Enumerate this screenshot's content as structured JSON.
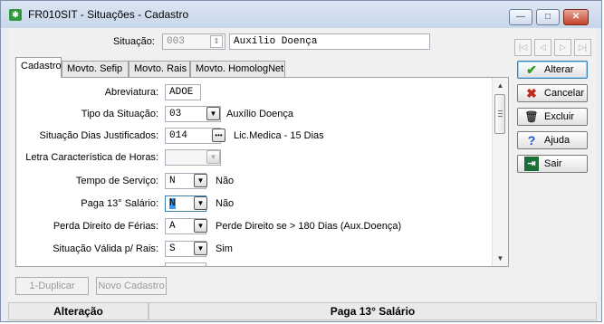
{
  "window": {
    "title": "FR010SIT - Situações - Cadastro",
    "app_icon_glyph": "✱",
    "minimize_glyph": "—",
    "maximize_glyph": "□",
    "close_glyph": "✕"
  },
  "header": {
    "situacao_label": "Situação:",
    "situacao_code": "003",
    "situacao_desc": "Auxílio Doença"
  },
  "nav_buttons": [
    "|◁",
    "◁",
    "▷",
    "▷|"
  ],
  "tabs": [
    {
      "label": "Cadastro",
      "active": true
    },
    {
      "label": "Movto. Sefip",
      "active": false
    },
    {
      "label": "Movto. Rais",
      "active": false
    },
    {
      "label": "Movto. HomologNet",
      "active": false
    }
  ],
  "form": {
    "abreviatura": {
      "label": "Abreviatura:",
      "value": "ADOE"
    },
    "tipo_situacao": {
      "label": "Tipo da Situação:",
      "value": "03",
      "desc": "Auxílio Doença"
    },
    "dias_justificados": {
      "label": "Situação Dias Justificados:",
      "value": "014",
      "button": "•••",
      "desc": "Lic.Medica - 15 Dias"
    },
    "letra_horas": {
      "label": "Letra Característica de Horas:",
      "value": ""
    },
    "tempo_servico": {
      "label": "Tempo de Serviço:",
      "value": "N",
      "desc": "Não"
    },
    "paga_13": {
      "label": "Paga 13° Salário:",
      "value": "N",
      "desc": "Não"
    },
    "perda_ferias": {
      "label": "Perda Direito de Férias:",
      "value": "A",
      "desc": "Perde Direito se > 180 Dias (Aux.Doença)"
    },
    "valida_rais": {
      "label": "Situação Válida p/ Rais:",
      "value": "S",
      "desc": "Sim"
    }
  },
  "actions": [
    {
      "label": "Alterar",
      "icon": "check-icon",
      "glyph": "✔",
      "color": "#2a9a2a"
    },
    {
      "label": "Cancelar",
      "icon": "x-icon",
      "glyph": "✖",
      "color": "#c0281c"
    },
    {
      "label": "Excluir",
      "icon": "trash-icon",
      "glyph": "🗑",
      "color": "#333333"
    },
    {
      "label": "Ajuda",
      "icon": "help-icon",
      "glyph": "?",
      "color": "#1b54c8"
    },
    {
      "label": "Sair",
      "icon": "exit-icon",
      "glyph": "⇥",
      "color": "#1b6e3a"
    }
  ],
  "bottom_buttons": {
    "duplicar": "1-Duplicar",
    "novo_cadastro": "Novo Cadastro"
  },
  "status": {
    "mode": "Alteração",
    "field": "Paga 13° Salário"
  }
}
